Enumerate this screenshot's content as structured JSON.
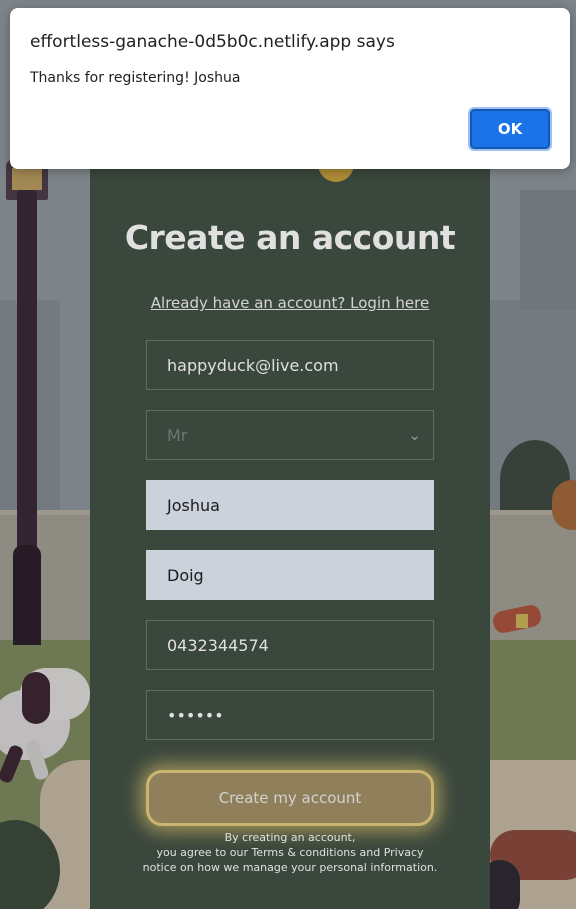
{
  "browser": {
    "tab_fragment": "5"
  },
  "dialog": {
    "title": "effortless-ganache-0d5b0c.netlify.app says",
    "message": "Thanks for registering! Joshua",
    "ok_label": "OK",
    "ok_color": "#1a73e8"
  },
  "form": {
    "title": "Create an account",
    "login_link": "Already have an account? Login here",
    "email_value": "happyduck@live.com",
    "title_select_value": "Mr",
    "first_name_value": "Joshua",
    "last_name_value": "Doig",
    "phone_value": "0432344574",
    "password_value": "••••••",
    "submit_label": "Create my account",
    "legal_line1": "By creating an account,",
    "legal_line2": "you agree to our Terms & conditions and Privacy",
    "legal_line3": "notice on how we manage your personal information.",
    "card_color": "#435145",
    "button_color": "#a39168"
  },
  "icons": {
    "select_chevron": "chevron-down-icon"
  }
}
